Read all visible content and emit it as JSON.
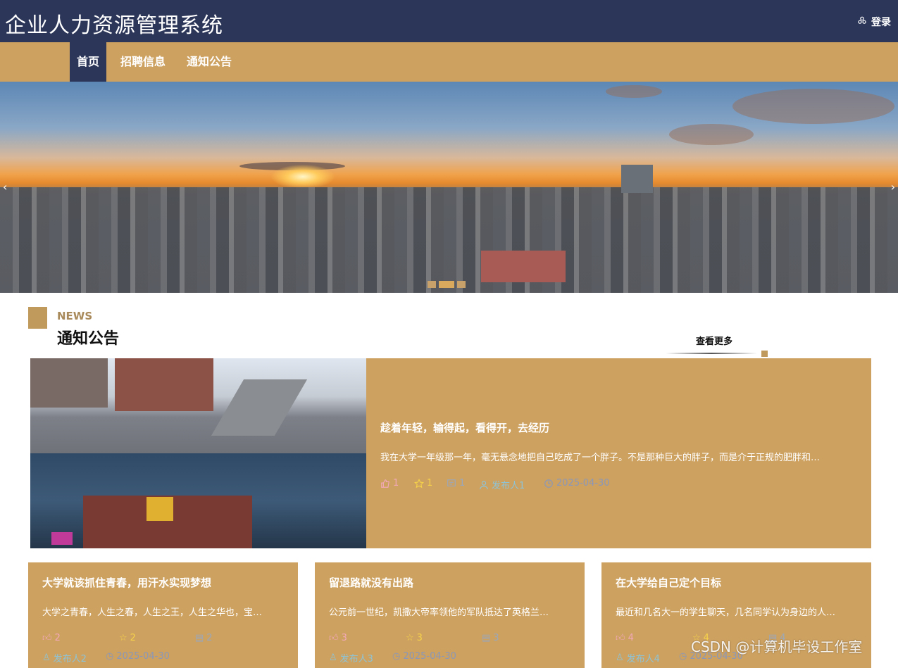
{
  "header": {
    "title": "企业人力资源管理系统",
    "login_label": "登录"
  },
  "nav": {
    "items": [
      {
        "label": "首页"
      },
      {
        "label": "招聘信息"
      },
      {
        "label": "通知公告"
      }
    ]
  },
  "section": {
    "en": "NEWS",
    "cn": "通知公告",
    "more": "查看更多"
  },
  "featured": {
    "title": "趁着年轻，输得起，看得开，去经历",
    "desc": "我在大学一年级那一年，毫无悬念地把自己吃成了一个胖子。不是那种巨大的胖子，而是介于正规的肥胖和…",
    "likes": "1",
    "stars": "1",
    "comments": "1",
    "author": "发布人1",
    "date": "2025-04-30"
  },
  "cards": [
    {
      "title": "大学就该抓住青春，用汗水实现梦想",
      "desc": "大学之青春，人生之春，人生之王，人生之华也，宝…",
      "likes": "2",
      "stars": "2",
      "comments": "2",
      "author": "发布人2",
      "date": "2025-04-30"
    },
    {
      "title": "留退路就没有出路",
      "desc": "公元前一世纪，凯撒大帝率领他的军队抵达了英格兰…",
      "likes": "3",
      "stars": "3",
      "comments": "3",
      "author": "发布人3",
      "date": "2025-04-30"
    },
    {
      "title": "在大学给自己定个目标",
      "desc": "最近和几名大一的学生聊天，几名同学认为身边的人…",
      "likes": "4",
      "stars": "4",
      "comments": "4",
      "author": "发布人4",
      "date": "2025-04-30"
    }
  ],
  "watermark": "CSDN @计算机毕设工作室",
  "colors": {
    "header": "#2c3659",
    "accent": "#cda160"
  }
}
